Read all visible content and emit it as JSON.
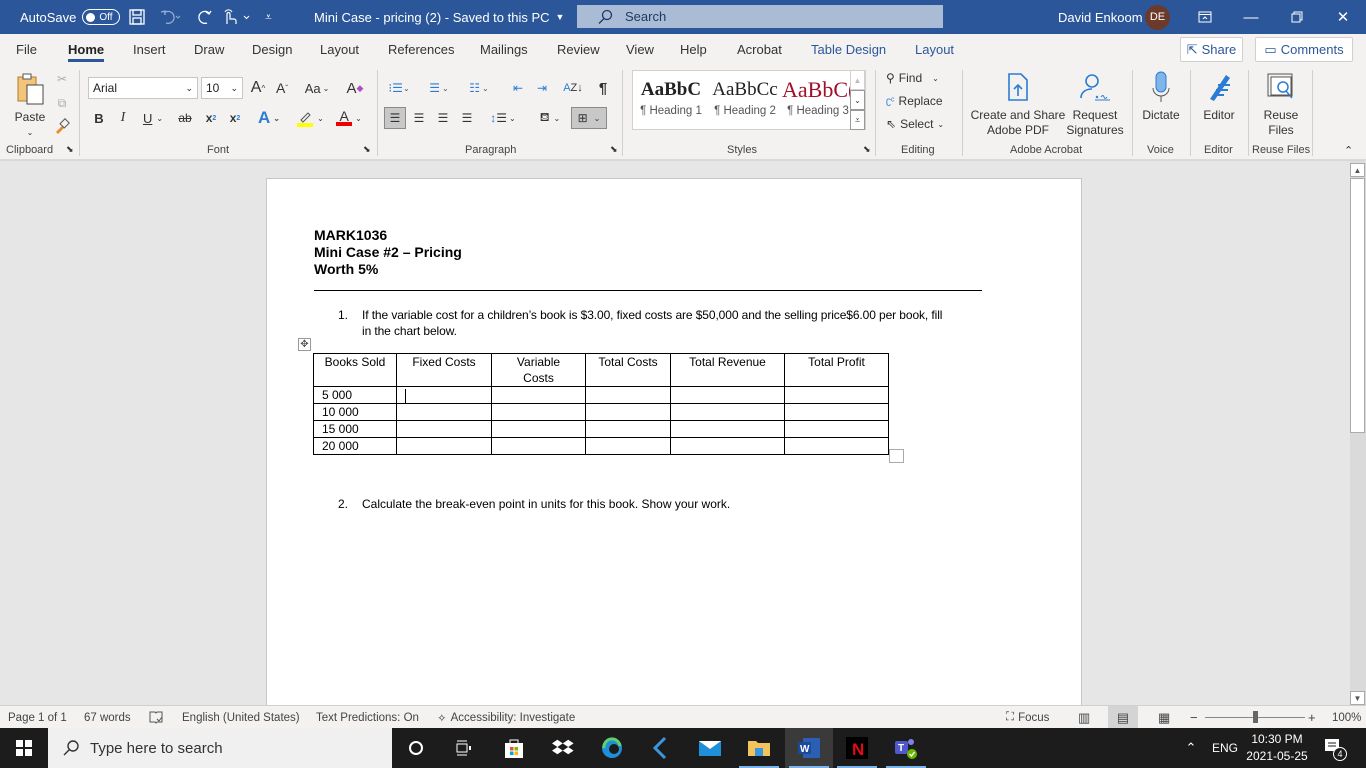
{
  "titlebar": {
    "autosave_label": "AutoSave",
    "autosave_state": "Off",
    "doc_title": "Mini Case - pricing (2)  -  Saved to this PC",
    "search_placeholder": "Search",
    "user_name": "David Enkoom",
    "user_initials": "DE"
  },
  "menu": {
    "tabs": [
      "File",
      "Home",
      "Insert",
      "Draw",
      "Design",
      "Layout",
      "References",
      "Mailings",
      "Review",
      "View",
      "Help",
      "Acrobat",
      "Table Design",
      "Layout"
    ],
    "active_tab": "Home",
    "share_label": "Share",
    "comments_label": "Comments"
  },
  "ribbon": {
    "clipboard": {
      "paste_label": "Paste",
      "group_label": "Clipboard"
    },
    "font": {
      "font_name": "Arial",
      "font_size": "10",
      "change_case_label": "Aa",
      "group_label": "Font"
    },
    "paragraph": {
      "group_label": "Paragraph"
    },
    "styles": {
      "items": [
        {
          "preview": "AaBbC",
          "name": "¶ Heading 1",
          "color": "#000000"
        },
        {
          "preview": "AaBbCc",
          "name": "¶ Heading 2",
          "color": "#000000"
        },
        {
          "preview": "AaBbC(",
          "name": "¶ Heading 3",
          "color": "#a0102a"
        }
      ],
      "group_label": "Styles"
    },
    "editing": {
      "find_label": "Find",
      "replace_label": "Replace",
      "select_label": "Select",
      "group_label": "Editing"
    },
    "acrobat": {
      "create_share_label_1": "Create and Share",
      "create_share_label_2": "Adobe PDF",
      "request_sig_label_1": "Request",
      "request_sig_label_2": "Signatures",
      "group_label": "Adobe Acrobat"
    },
    "voice": {
      "dictate_label": "Dictate",
      "group_label": "Voice"
    },
    "editor": {
      "editor_label": "Editor",
      "group_label": "Editor"
    },
    "reuse": {
      "reuse_label_1": "Reuse",
      "reuse_label_2": "Files",
      "group_label": "Reuse Files"
    }
  },
  "document": {
    "heading_lines": [
      "MARK1036",
      "Mini Case #2 – Pricing",
      "Worth 5%"
    ],
    "q1_number": "1.",
    "q1_text_line1": "If the variable cost for a children’s book is $3.00, fixed costs are $50,000 and the selling price$6.00 per book, fill",
    "q1_text_line2": "in the chart below.",
    "table": {
      "headers": [
        "Books Sold",
        "Fixed Costs",
        "Variable Costs",
        "Total Costs",
        "Total Revenue",
        "Total Profit"
      ],
      "rows": [
        [
          "5 000",
          "",
          "",
          "",
          "",
          ""
        ],
        [
          "10 000",
          "",
          "",
          "",
          "",
          ""
        ],
        [
          "15 000",
          "",
          "",
          "",
          "",
          ""
        ],
        [
          "20 000",
          "",
          "",
          "",
          "",
          ""
        ]
      ]
    },
    "q2_number": "2.",
    "q2_text": "Calculate the break-even point in units for this book.  Show your work."
  },
  "statusbar": {
    "page": "Page 1 of 1",
    "words": "67 words",
    "language": "English (United States)",
    "text_predictions": "Text Predictions: On",
    "accessibility": "Accessibility: Investigate",
    "focus_label": "Focus",
    "zoom_level": "100%",
    "zoom_percent": 100
  },
  "taskbar": {
    "search_placeholder": "Type here to search",
    "language": "ENG",
    "time": "10:30 PM",
    "date": "2021-05-25",
    "notification_count": "4"
  }
}
